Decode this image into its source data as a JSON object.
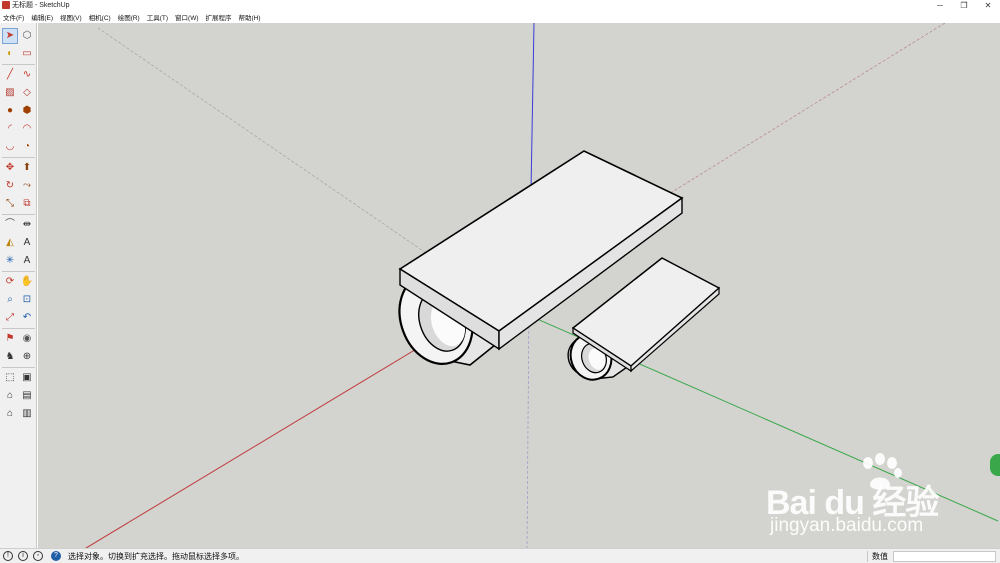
{
  "window": {
    "title": "无标题 - SketchUp",
    "minimize_glyph": "─",
    "restore_glyph": "❐",
    "close_glyph": "✕"
  },
  "menu": [
    "文件(F)",
    "编辑(E)",
    "视图(V)",
    "相机(C)",
    "绘图(R)",
    "工具(T)",
    "窗口(W)",
    "扩展程序",
    "帮助(H)"
  ],
  "toolbar": {
    "tools": [
      "select-icon",
      "component-icon",
      "paint-bucket-icon",
      "eraser-icon",
      "pencil-line-icon",
      "freehand-icon",
      "rectangle-icon",
      "rotated-rectangle-icon",
      "circle-icon",
      "polygon-icon",
      "arc-icon",
      "two-point-arc-icon",
      "three-point-arc-icon",
      "pie-icon",
      "move-icon",
      "push-pull-icon",
      "rotate-icon",
      "follow-me-icon",
      "scale-icon",
      "offset-icon",
      "tape-measure-icon",
      "dimension-icon",
      "protractor-icon",
      "text-icon",
      "axes-icon",
      "3d-text-icon",
      "orbit-icon",
      "pan-icon",
      "zoom-icon",
      "zoom-window-icon",
      "zoom-extents-icon",
      "previous-view-icon",
      "position-camera-icon",
      "look-around-icon",
      "walk-icon",
      "section-plane-icon",
      "iso-view-icon",
      "top-view-icon",
      "front-view-icon",
      "right-view-icon",
      "back-view-icon",
      "left-view-icon"
    ]
  },
  "viewport": {
    "background": "#d3d3cf",
    "axis_colors": {
      "red": "#c0393b",
      "green": "#3aa84a",
      "blue": "#3b3bd6"
    },
    "face_color": "#efefef"
  },
  "watermark": {
    "main": "Bai du 经验",
    "sub": "jingyan.baidu.com"
  },
  "status": {
    "message": "选择对象。切换到扩充选择。拖动鼠标选择多项。",
    "measure_label": "数值",
    "measure_value": "",
    "help_glyph": "?"
  }
}
